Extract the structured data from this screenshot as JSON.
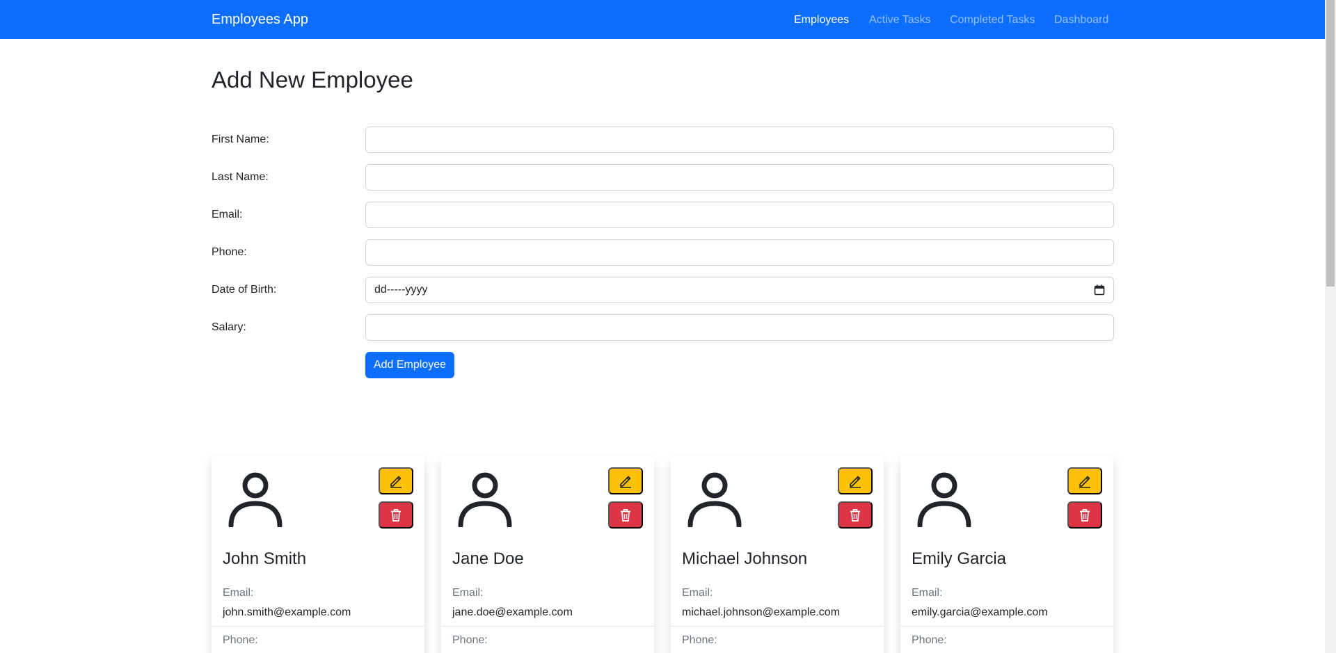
{
  "navbar": {
    "brand": "Employees App",
    "links": [
      "Employees",
      "Active Tasks",
      "Completed Tasks",
      "Dashboard"
    ]
  },
  "form": {
    "title": "Add New Employee",
    "fields": [
      {
        "label": "First Name:",
        "value": ""
      },
      {
        "label": "Last Name:",
        "value": ""
      },
      {
        "label": "Email:",
        "value": ""
      },
      {
        "label": "Phone:",
        "value": ""
      },
      {
        "label": "Date of Birth:",
        "value": "dd-----yyyy"
      },
      {
        "label": "Salary:",
        "value": ""
      }
    ],
    "submit_label": "Add Employee"
  },
  "cards": [
    {
      "name": "John Smith",
      "email_label": "Email:",
      "email": "john.smith@example.com",
      "phone_label": "Phone:"
    },
    {
      "name": "Jane Doe",
      "email_label": "Email:",
      "email": "jane.doe@example.com",
      "phone_label": "Phone:"
    },
    {
      "name": "Michael Johnson",
      "email_label": "Email:",
      "email": "michael.johnson@example.com",
      "phone_label": "Phone:"
    },
    {
      "name": "Emily Garcia",
      "email_label": "Email:",
      "email": "emily.garcia@example.com",
      "phone_label": "Phone:"
    }
  ],
  "icons": {
    "avatar": "person-icon",
    "edit": "pencil-icon",
    "delete": "trash-icon",
    "date": "calendar-icon"
  },
  "colors": {
    "primary": "#0d6efd",
    "warning": "#ffc107",
    "danger": "#dc3545"
  }
}
